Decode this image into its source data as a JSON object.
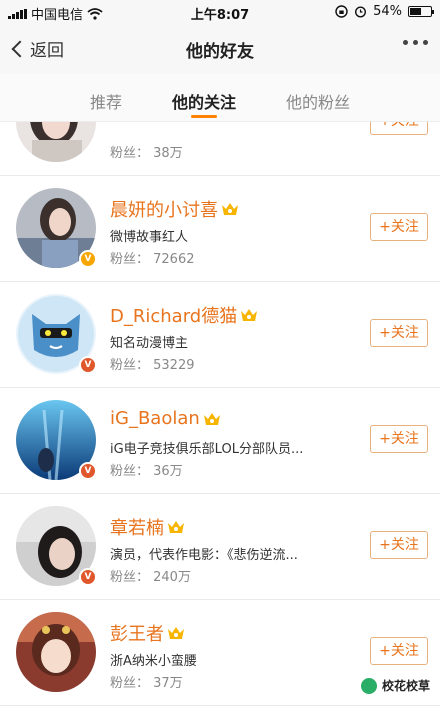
{
  "status_bar": {
    "carrier": "中国电信",
    "time": "上午8:07",
    "battery": "54%",
    "battery_level": 0.54
  },
  "nav": {
    "back_label": "返回",
    "title": "他的好友"
  },
  "tabs": [
    {
      "label": "推荐"
    },
    {
      "label": "他的关注"
    },
    {
      "label": "他的粉丝"
    }
  ],
  "accent_color": "#ff8200",
  "follow_label": "+关注",
  "users": [
    {
      "name": "",
      "description": "",
      "fans": "粉丝： 38万"
    },
    {
      "name": "晨妍的小讨喜",
      "description": "微博故事红人",
      "fans": "粉丝： 72662"
    },
    {
      "name": "D_Richard德猫",
      "description": "知名动漫博主",
      "fans": "粉丝： 53229"
    },
    {
      "name": "iG_Baolan",
      "description": "iG电子竞技俱乐部LOL分部队员...",
      "fans": "粉丝： 36万"
    },
    {
      "name": "章若楠",
      "description": "演员，代表作电影：《悲伤逆流...",
      "fans": "粉丝： 240万"
    },
    {
      "name": "彭王者",
      "description": "浙A纳米小蛮腰",
      "fans": "粉丝： 37万"
    }
  ],
  "watermark": {
    "text": "校花校草"
  }
}
